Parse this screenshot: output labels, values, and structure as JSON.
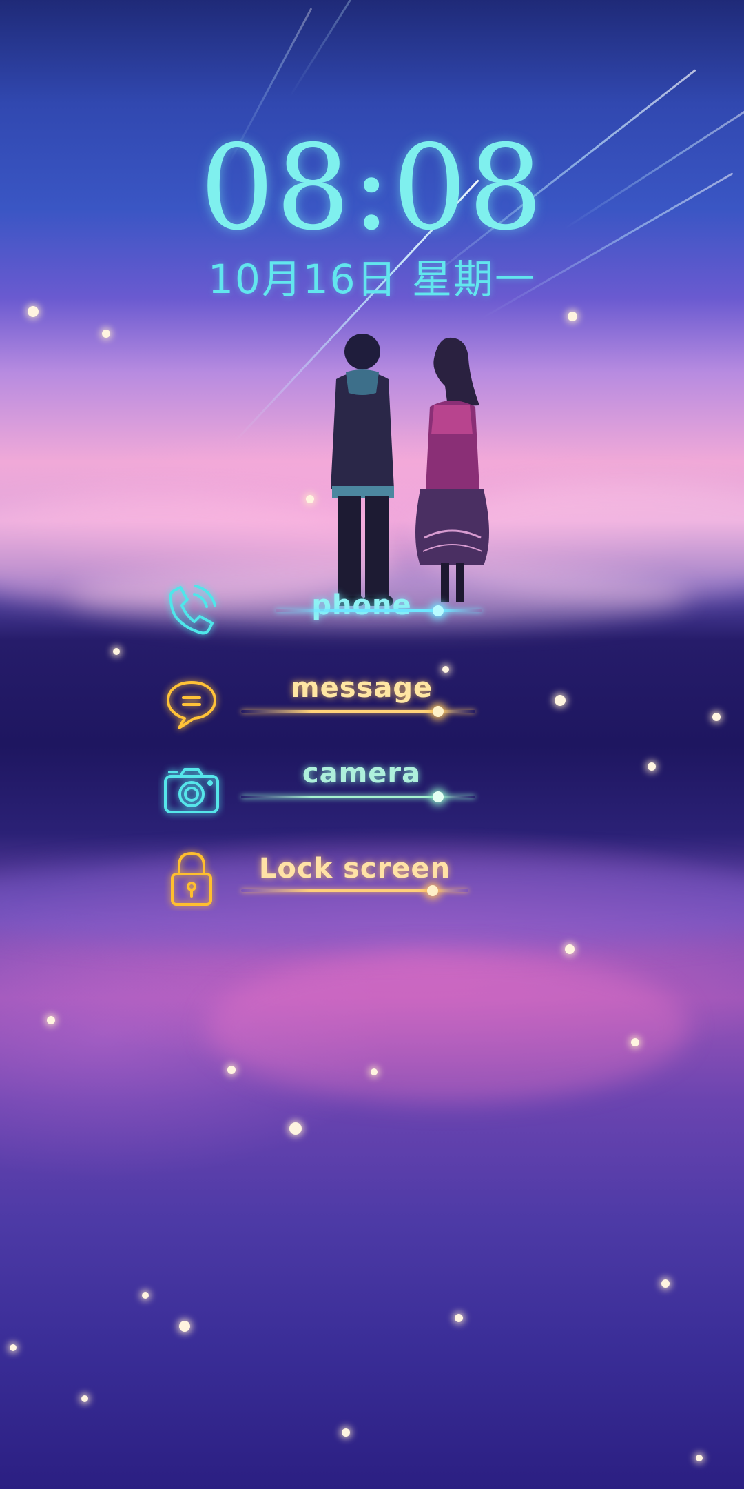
{
  "lockscreen": {
    "time": "08:08",
    "date": "10月16日  星期一"
  },
  "shortcuts": [
    {
      "label": "phone",
      "icon": "phone-icon",
      "color": "#6fe6ff"
    },
    {
      "label": "message",
      "icon": "message-icon",
      "color": "#ffc85a"
    },
    {
      "label": "camera",
      "icon": "camera-icon",
      "color": "#8ef0c8"
    },
    {
      "label": "Lock screen",
      "icon": "lock-icon",
      "color": "#ffc060"
    }
  ],
  "wallpaper": {
    "icon": "starry-sky-wallpaper",
    "colors": {
      "sky_top": "#1f2a78",
      "horizon": "#f0a9d8",
      "night": "#1e1660",
      "reflection": "#9b55b8"
    }
  }
}
